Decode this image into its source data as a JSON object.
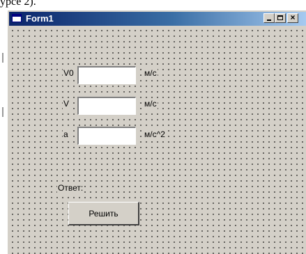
{
  "document": {
    "fragment_text": "урсе 2)."
  },
  "window": {
    "title": "Form1",
    "caption_buttons": {
      "minimize_icon": "minimize-icon",
      "maximize_icon": "maximize-icon",
      "close_icon": "close-icon",
      "close_glyph": "×"
    }
  },
  "form": {
    "fields": [
      {
        "label": "V0",
        "value": "",
        "unit": "м/с"
      },
      {
        "label": "V",
        "value": "",
        "unit": "м/с"
      },
      {
        "label": "a",
        "value": "",
        "unit": "м/с^2"
      }
    ],
    "answer_label": "Ответ:",
    "solve_button": "Решить"
  },
  "colors": {
    "titlebar_start": "#0a246a",
    "titlebar_end": "#a6caf0",
    "face": "#d4d0c8"
  }
}
